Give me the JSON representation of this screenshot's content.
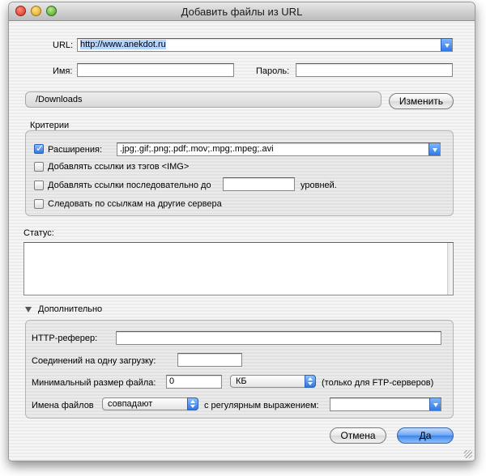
{
  "window": {
    "title": "Добавить файлы из URL"
  },
  "url": {
    "label": "URL:",
    "value": "http://www.anekdot.ru"
  },
  "name": {
    "label": "Имя:",
    "value": ""
  },
  "password": {
    "label": "Пароль:",
    "value": ""
  },
  "path": {
    "value": "/Downloads",
    "change_button": "Изменить"
  },
  "criteria": {
    "title": "Критерии",
    "extensions": {
      "label": "Расширения:",
      "checked": true,
      "value": ".jpg;.gif;.png;.pdf;.mov;.mpg;.mpeg;.avi"
    },
    "img_links": {
      "label": "Добавлять ссылки из тэгов <IMG>",
      "checked": false
    },
    "follow_depth": {
      "label": "Добавлять ссылки последовательно до",
      "value": "",
      "suffix": "уровней.",
      "checked": false
    },
    "other_servers": {
      "label": "Следовать по ссылкам на другие сервера",
      "checked": false
    }
  },
  "status": {
    "label": "Статус:",
    "value": ""
  },
  "advanced": {
    "title": "Дополнительно",
    "referer": {
      "label": "HTTP-реферер:",
      "value": ""
    },
    "connections": {
      "label": "Соединений на одну загрузку:",
      "value": ""
    },
    "min_size": {
      "label": "Минимальный размер файла:",
      "value": "0",
      "unit": "КБ",
      "note": "(только для FTP-серверов)"
    },
    "filenames": {
      "label": "Имена файлов",
      "match": "совпадают",
      "regex_label": "с регулярным выражением:",
      "regex_value": ""
    }
  },
  "buttons": {
    "cancel": "Отмена",
    "ok": "Да"
  },
  "colors": {
    "accent": "#3176e0",
    "selection": "#b5d5ff"
  }
}
